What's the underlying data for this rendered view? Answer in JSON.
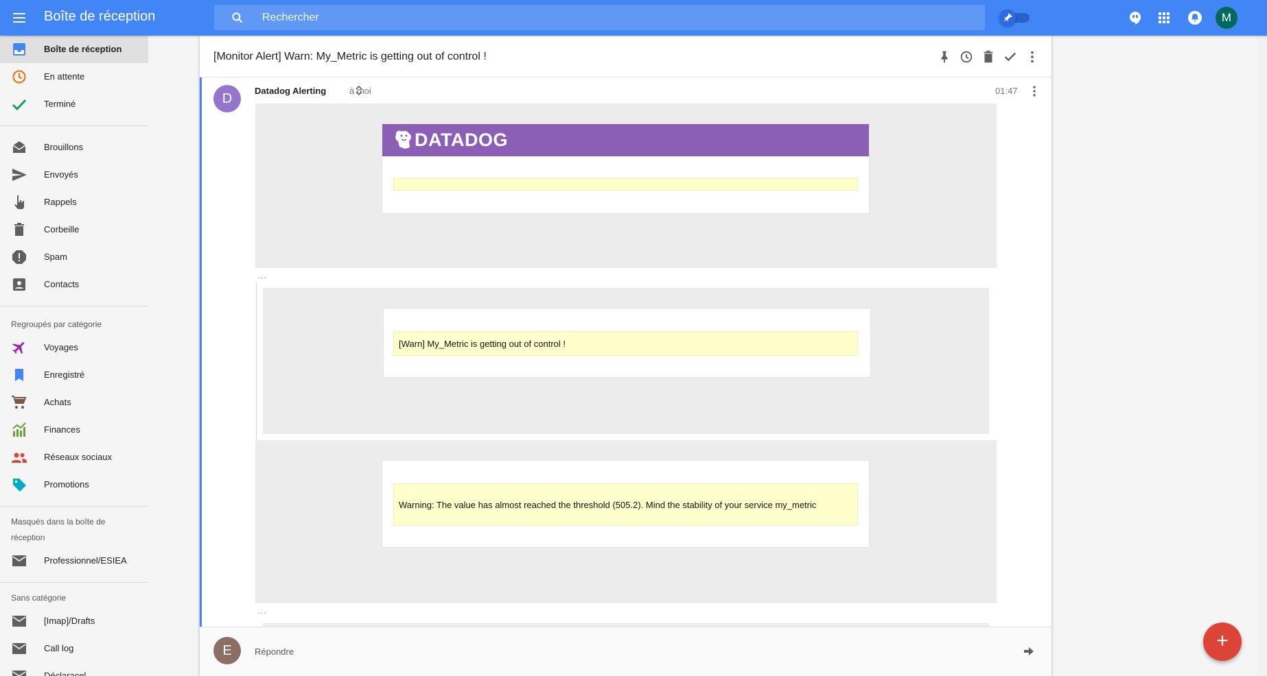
{
  "app": {
    "title": "Boîte de réception"
  },
  "search": {
    "placeholder": "Rechercher"
  },
  "account": {
    "avatar_letter": "M"
  },
  "sidebar": {
    "primary": [
      {
        "label": "Boîte de réception",
        "icon": "inbox-icon",
        "active": true
      },
      {
        "label": "En attente",
        "icon": "clock-icon"
      },
      {
        "label": "Terminé",
        "icon": "check-icon"
      }
    ],
    "folders": [
      {
        "label": "Brouillons",
        "icon": "drafts-icon"
      },
      {
        "label": "Envoyés",
        "icon": "send-icon"
      },
      {
        "label": "Rappels",
        "icon": "reminder-hand-icon"
      },
      {
        "label": "Corbeille",
        "icon": "trash-icon"
      },
      {
        "label": "Spam",
        "icon": "spam-icon"
      },
      {
        "label": "Contacts",
        "icon": "contacts-icon"
      }
    ],
    "bundles_title": "Regroupés par catégorie",
    "bundles": [
      {
        "label": "Voyages",
        "icon": "plane-icon",
        "color": "#9c27b0"
      },
      {
        "label": "Enregistré",
        "icon": "bookmark-icon",
        "color": "#4285f4"
      },
      {
        "label": "Achats",
        "icon": "cart-icon",
        "color": "#795548"
      },
      {
        "label": "Finances",
        "icon": "finance-chart-icon",
        "color": "#689f38"
      },
      {
        "label": "Réseaux sociaux",
        "icon": "people-icon",
        "color": "#db4437"
      },
      {
        "label": "Promotions",
        "icon": "tag-icon",
        "color": "#00acc1"
      }
    ],
    "hidden_title": "Masqués dans la boîte de réception",
    "hidden": [
      {
        "label": "Professionnel/ESIEA",
        "icon": "mail-icon"
      }
    ],
    "uncategorized_title": "Sans catégorie",
    "uncategorized": [
      {
        "label": "[Imap]/Drafts",
        "icon": "mail-icon"
      },
      {
        "label": "Call log",
        "icon": "mail-icon"
      },
      {
        "label": "Déclaracel",
        "icon": "mail-icon"
      }
    ]
  },
  "thread": {
    "subject": "[Monitor Alert] Warn: My_Metric is getting out of control !",
    "message": {
      "sender_initial": "D",
      "sender": "Datadog Alerting",
      "to": "à moi",
      "time": "01:47",
      "brand": "DATADOG",
      "ellipsis": "...",
      "alert_title": "[Warn] My_Metric is getting out of control !",
      "alert_text": "Warning: The value has almost reached the threshold (505.2). Mind the stability of your service my_metric"
    },
    "reply": {
      "avatar_letter": "E",
      "label": "Répondre"
    }
  },
  "fab": {
    "label": "+"
  }
}
